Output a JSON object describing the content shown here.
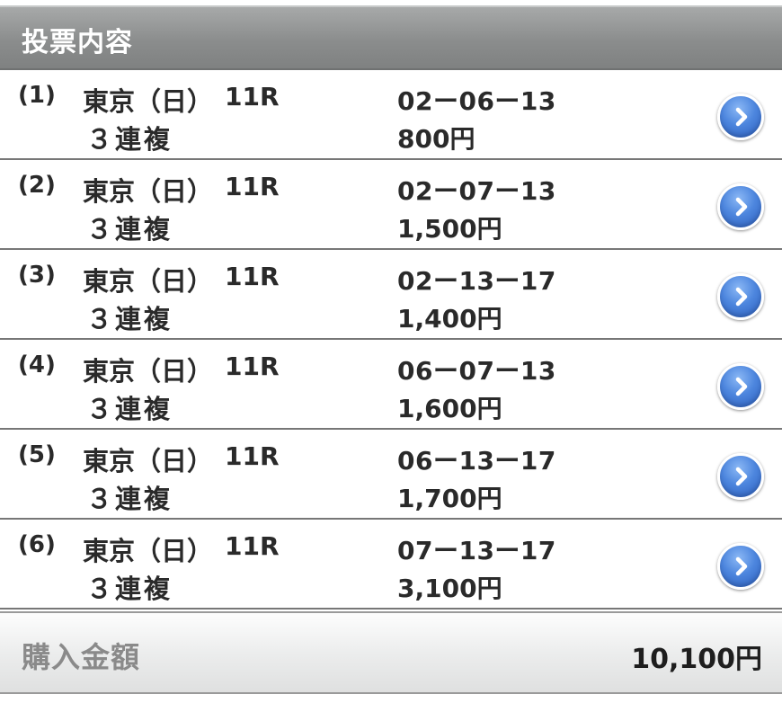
{
  "header": {
    "title": "投票内容"
  },
  "bets": [
    {
      "num": "(1)",
      "venue": "東京（日）",
      "race": "11R",
      "bet_type": "３連複",
      "combo": "02ー06ー13",
      "amount": "800円"
    },
    {
      "num": "(2)",
      "venue": "東京（日）",
      "race": "11R",
      "bet_type": "３連複",
      "combo": "02ー07ー13",
      "amount": "1,500円"
    },
    {
      "num": "(3)",
      "venue": "東京（日）",
      "race": "11R",
      "bet_type": "３連複",
      "combo": "02ー13ー17",
      "amount": "1,400円"
    },
    {
      "num": "(4)",
      "venue": "東京（日）",
      "race": "11R",
      "bet_type": "３連複",
      "combo": "06ー07ー13",
      "amount": "1,600円"
    },
    {
      "num": "(5)",
      "venue": "東京（日）",
      "race": "11R",
      "bet_type": "３連複",
      "combo": "06ー13ー17",
      "amount": "1,700円"
    },
    {
      "num": "(6)",
      "venue": "東京（日）",
      "race": "11R",
      "bet_type": "３連複",
      "combo": "07ー13ー17",
      "amount": "3,100円"
    }
  ],
  "total": {
    "label": "購入金額",
    "value": "10,100円"
  },
  "icons": {
    "row_action": "chevron-right-circle-icon"
  },
  "colors": {
    "header_bg": "#8f9191",
    "accent_blue": "#3f78d6"
  }
}
